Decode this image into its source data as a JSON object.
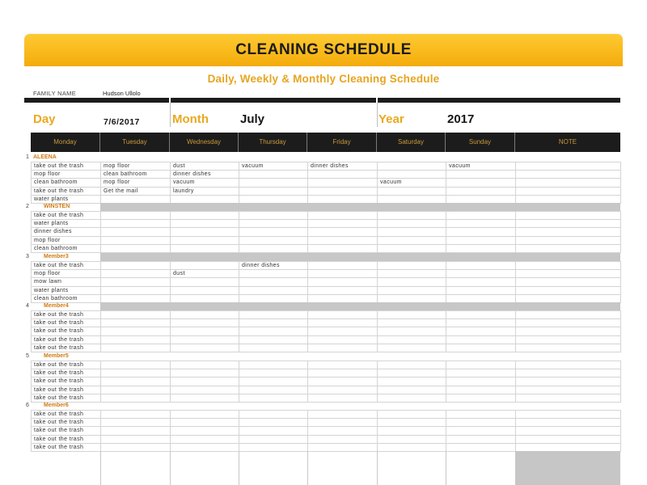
{
  "title": "CLEANING SCHEDULE",
  "subtitle": "Daily, Weekly & Monthly Cleaning Schedule",
  "family": {
    "label": "FAMILY NAME",
    "value": "Hudson Ullolo"
  },
  "date_fields": {
    "day_label": "Day",
    "day_value": "7/6/2017",
    "month_label": "Month",
    "month_value": "July",
    "year_label": "Year",
    "year_value": "2017"
  },
  "columns": [
    "Monday",
    "Tuesday",
    "Wednesday",
    "Thursday",
    "Friday",
    "Saturday",
    "Sunday",
    "NOTE"
  ],
  "colors": {
    "accent": "#e9a91e",
    "banner": "#f8b81a",
    "header_bg": "#1c1c1c",
    "header_text": "#c99a3a",
    "member_name": "#d07a10",
    "band_gray": "#c7c7c7"
  },
  "members": [
    {
      "num": "1",
      "name": "ALEENA",
      "band": false,
      "rows": [
        [
          "take out the trash",
          "mop floor",
          "dust",
          "vacuum",
          "dinner dishes",
          "",
          "vacuum",
          ""
        ],
        [
          "mop floor",
          "clean bathroom",
          "dinner dishes",
          "",
          "",
          "",
          "",
          ""
        ],
        [
          "clean bathroom",
          "mop floor",
          "vacuum",
          "",
          "",
          "vacuum",
          "",
          ""
        ],
        [
          "take out the trash",
          "Get the mail",
          "laundry",
          "",
          "",
          "",
          "",
          ""
        ],
        [
          "water plants",
          "",
          "",
          "",
          "",
          "",
          "",
          ""
        ]
      ]
    },
    {
      "num": "2",
      "name": "WINSTEN",
      "band": true,
      "rows": [
        [
          "take out the trash",
          "",
          "",
          "",
          "",
          "",
          "",
          ""
        ],
        [
          "water plants",
          "",
          "",
          "",
          "",
          "",
          "",
          ""
        ],
        [
          "dinner dishes",
          "",
          "",
          "",
          "",
          "",
          "",
          ""
        ],
        [
          "mop floor",
          "",
          "",
          "",
          "",
          "",
          "",
          ""
        ],
        [
          "clean bathroom",
          "",
          "",
          "",
          "",
          "",
          "",
          ""
        ]
      ]
    },
    {
      "num": "3",
      "name": "Member3",
      "band": true,
      "rows": [
        [
          "take out the trash",
          "",
          "",
          "dinner dishes",
          "",
          "",
          "",
          ""
        ],
        [
          "mop floor",
          "",
          "dust",
          "",
          "",
          "",
          "",
          ""
        ],
        [
          "mow lawn",
          "",
          "",
          "",
          "",
          "",
          "",
          ""
        ],
        [
          "water plants",
          "",
          "",
          "",
          "",
          "",
          "",
          ""
        ],
        [
          "clean bathroom",
          "",
          "",
          "",
          "",
          "",
          "",
          ""
        ]
      ]
    },
    {
      "num": "4",
      "name": "Member4",
      "band": true,
      "rows": [
        [
          "take out the trash",
          "",
          "",
          "",
          "",
          "",
          "",
          ""
        ],
        [
          "take out the trash",
          "",
          "",
          "",
          "",
          "",
          "",
          ""
        ],
        [
          "take out the trash",
          "",
          "",
          "",
          "",
          "",
          "",
          ""
        ],
        [
          "take out the trash",
          "",
          "",
          "",
          "",
          "",
          "",
          ""
        ],
        [
          "take out the trash",
          "",
          "",
          "",
          "",
          "",
          "",
          ""
        ]
      ]
    },
    {
      "num": "5",
      "name": "Member5",
      "band": false,
      "rows": [
        [
          "take out the trash",
          "",
          "",
          "",
          "",
          "",
          "",
          ""
        ],
        [
          "take out the trash",
          "",
          "",
          "",
          "",
          "",
          "",
          ""
        ],
        [
          "take out the trash",
          "",
          "",
          "",
          "",
          "",
          "",
          ""
        ],
        [
          "take out the trash",
          "",
          "",
          "",
          "",
          "",
          "",
          ""
        ],
        [
          "take out the trash",
          "",
          "",
          "",
          "",
          "",
          "",
          ""
        ]
      ]
    },
    {
      "num": "6",
      "name": "Member6",
      "band": false,
      "rows": [
        [
          "take out the trash",
          "",
          "",
          "",
          "",
          "",
          "",
          ""
        ],
        [
          "take out the trash",
          "",
          "",
          "",
          "",
          "",
          "",
          ""
        ],
        [
          "take out the trash",
          "",
          "",
          "",
          "",
          "",
          "",
          ""
        ],
        [
          "take out the trash",
          "",
          "",
          "",
          "",
          "",
          "",
          ""
        ],
        [
          "take out the trash",
          "",
          "",
          "",
          "",
          "",
          "",
          ""
        ]
      ]
    }
  ]
}
